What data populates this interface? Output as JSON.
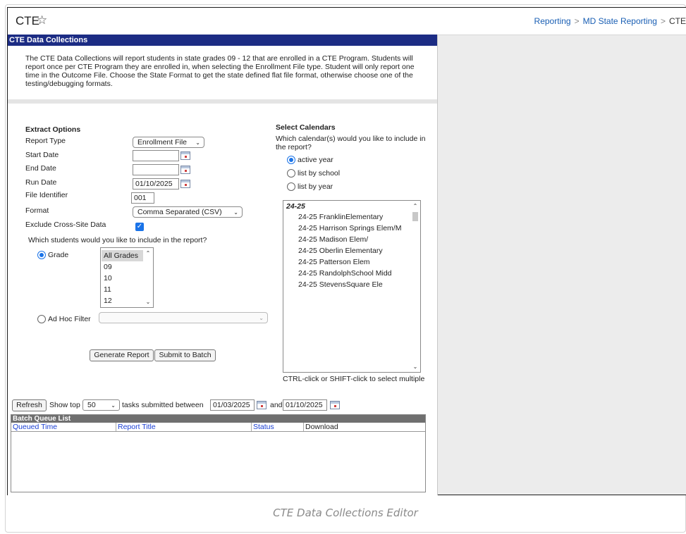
{
  "header": {
    "title": "CTE",
    "breadcrumb": [
      "Reporting",
      "MD State Reporting",
      "CTE"
    ]
  },
  "panel": {
    "title": "CTE Data Collections",
    "description": "The CTE Data Collections will report students in state grades 09 - 12 that are enrolled in a CTE Program. Students will report once per CTE Program they are enrolled in, when selecting the Enrollment File type. Student will only report one time in the Outcome File. Choose the State Format to get the state defined flat file format, otherwise choose one of the testing/debugging formats."
  },
  "extract": {
    "heading": "Extract Options",
    "report_type_label": "Report Type",
    "report_type_value": "Enrollment File",
    "start_date_label": "Start Date",
    "start_date_value": "",
    "end_date_label": "End Date",
    "end_date_value": "",
    "run_date_label": "Run Date",
    "run_date_value": "01/10/2025",
    "file_identifier_label": "File Identifier",
    "file_identifier_value": "001",
    "format_label": "Format",
    "format_value": "Comma Separated (CSV)",
    "exclude_label": "Exclude Cross-Site Data",
    "exclude_checked": true,
    "students_question": "Which students would you like to include in the report?",
    "grade_label": "Grade",
    "grades": [
      "All Grades",
      "09",
      "10",
      "11",
      "12"
    ],
    "adhoc_label": "Ad Hoc Filter",
    "adhoc_value": ""
  },
  "calendars": {
    "heading": "Select Calendars",
    "question": "Which calendar(s) would you like to include in the report?",
    "options": [
      "active year",
      "list by school",
      "list by year"
    ],
    "selected_option": "active year",
    "group": "24-25",
    "items": [
      "24-25 FranklinElementary",
      "24-25 Harrison Springs Elem/M",
      "24-25 Madison Elem/",
      "24-25 Oberlin Elementary",
      "24-25 Patterson Elem",
      "24-25 RandolphSchool Midd",
      "24-25 StevensSquare Ele"
    ],
    "hint": "CTRL-click or SHIFT-click to select multiple"
  },
  "actions": {
    "generate": "Generate Report",
    "submit": "Submit to Batch"
  },
  "batch": {
    "refresh": "Refresh",
    "show_top_label": "Show top",
    "show_top_value": "50",
    "between_label": "tasks submitted between",
    "from_date": "01/03/2025",
    "and_label": "and",
    "to_date": "01/10/2025",
    "list_title": "Batch Queue List",
    "columns": [
      "Queued Time",
      "Report Title",
      "Status",
      "Download"
    ]
  },
  "caption": "CTE Data Collections Editor"
}
